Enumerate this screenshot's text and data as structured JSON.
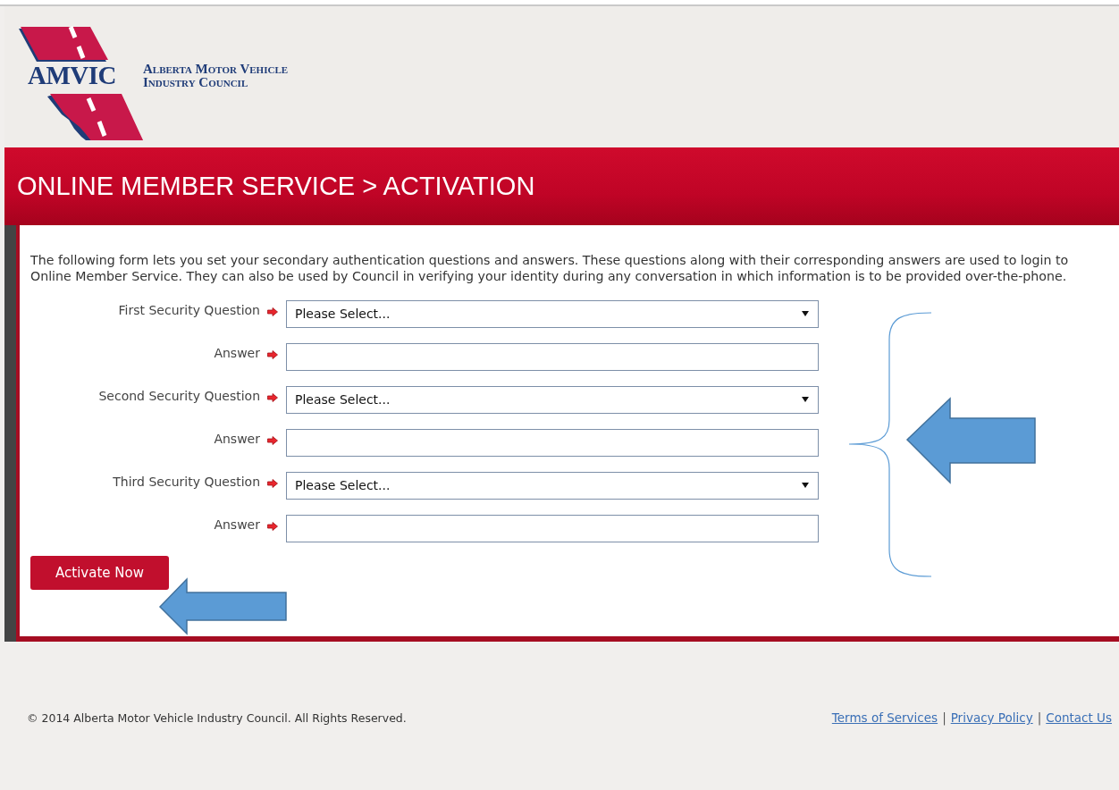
{
  "logo": {
    "acronym": "AMVIC",
    "name_line_1": "Alberta Motor Vehicle",
    "name_line_2": "Industry Council"
  },
  "banner_title": "ONLINE MEMBER SERVICE > ACTIVATION",
  "intro": "The following form lets you set your secondary authentication questions and answers. These questions along with their corresponding answers are used to login to Online Member Service. They can also be used by Council in verifying your identity during any conversation in which information is to be provided over-the-phone.",
  "fields": [
    {
      "kind": "select",
      "label": "First Security Question",
      "value": "Please Select..."
    },
    {
      "kind": "text",
      "label": "Answer"
    },
    {
      "kind": "select",
      "label": "Second Security Question",
      "value": "Please Select..."
    },
    {
      "kind": "text",
      "label": "Answer"
    },
    {
      "kind": "select",
      "label": "Third Security Question",
      "value": "Please Select..."
    },
    {
      "kind": "text",
      "label": "Answer"
    }
  ],
  "submit_button": "Activate Now",
  "footer": {
    "copyright": "© 2014 Alberta Motor Vehicle Industry Council. All Rights Reserved.",
    "links": [
      "Terms of Services",
      "Privacy Policy",
      "Contact Us"
    ],
    "separator": "|"
  }
}
